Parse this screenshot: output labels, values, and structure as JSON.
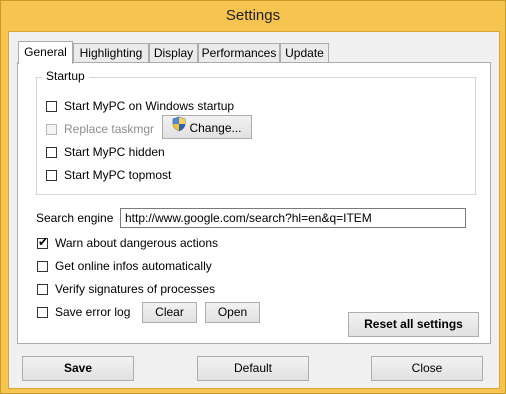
{
  "window": {
    "title": "Settings"
  },
  "tabs": [
    "General",
    "Highlighting",
    "Display",
    "Performances",
    "Update"
  ],
  "startup": {
    "group_label": "Startup",
    "items": [
      {
        "label": "Start MyPC on Windows startup",
        "checked": false,
        "enabled": true
      },
      {
        "label": "Replace taskmgr",
        "checked": false,
        "enabled": false
      },
      {
        "label": "Start MyPC hidden",
        "checked": false,
        "enabled": true
      },
      {
        "label": "Start MyPC topmost",
        "checked": false,
        "enabled": true
      }
    ],
    "change_button": "Change...",
    "change_icon": "uac-shield-icon"
  },
  "search": {
    "label": "Search engine",
    "value": "http://www.google.com/search?hl=en&q=ITEM"
  },
  "options": [
    {
      "label": "Warn about dangerous actions",
      "checked": true
    },
    {
      "label": "Get online infos automatically",
      "checked": false
    },
    {
      "label": "Verify signatures of processes",
      "checked": false
    },
    {
      "label": "Save error log",
      "checked": false
    }
  ],
  "log_buttons": {
    "clear": "Clear",
    "open": "Open"
  },
  "reset_button": "Reset all settings",
  "footer": {
    "save": "Save",
    "default": "Default",
    "close": "Close"
  },
  "colors": {
    "frame": "#f6c44f",
    "client": "#f0f0f0",
    "panel": "#ffffff"
  }
}
